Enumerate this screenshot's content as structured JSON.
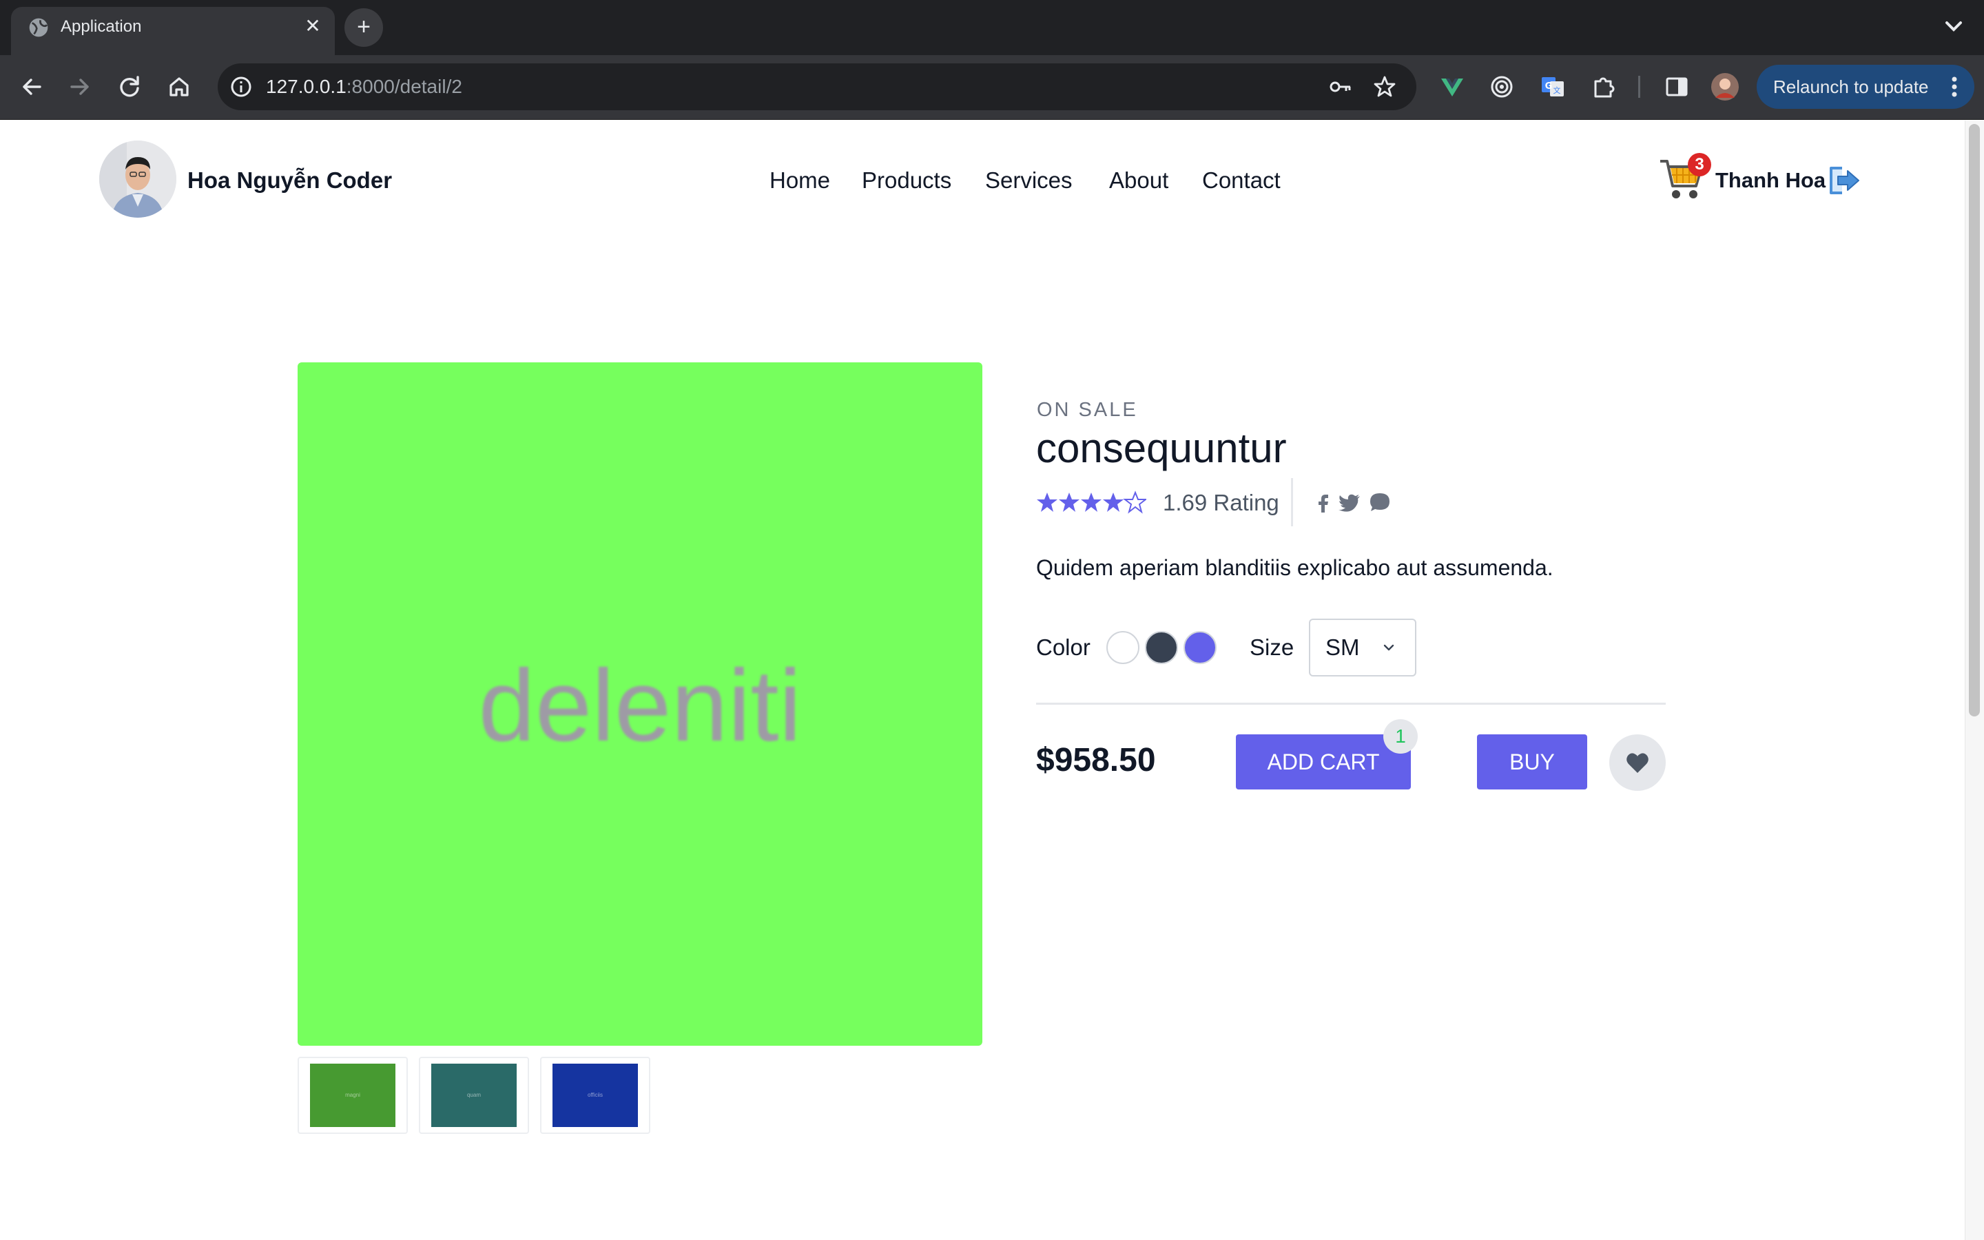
{
  "browser": {
    "tab_title": "Application",
    "new_tab_label": "+",
    "close_label": "✕",
    "url_host": "127.0.0.1",
    "url_path": ":8000/detail/2",
    "relaunch_label": "Relaunch to update"
  },
  "header": {
    "brand_name": "Hoa Nguyễn Coder",
    "nav": [
      "Home",
      "Products",
      "Services",
      "About",
      "Contact"
    ],
    "cart_count": "3",
    "user_name": "Thanh Hoa"
  },
  "product": {
    "hero_image_text": "deleniti",
    "hero_color": "#76ff5d",
    "thumbnails": [
      {
        "text": "magni",
        "color": "#479a31"
      },
      {
        "text": "quam",
        "color": "#2a6a68"
      },
      {
        "text": "officiis",
        "color": "#1534a0"
      }
    ],
    "badge": "ON SALE",
    "name": "consequuntur",
    "rating_stars": 4,
    "rating_max": 5,
    "rating_text": "1.69 Rating",
    "description": "Quidem aperiam blanditiis explicabo aut assumenda.",
    "color_label": "Color",
    "colors": [
      "#ffffff",
      "#374151",
      "#6360ea"
    ],
    "size_label": "Size",
    "size_value": "SM",
    "price": "$958.50",
    "add_cart_label": "ADD CART",
    "cart_qty": "1",
    "buy_label": "BUY",
    "accent_color": "#6360ea"
  }
}
